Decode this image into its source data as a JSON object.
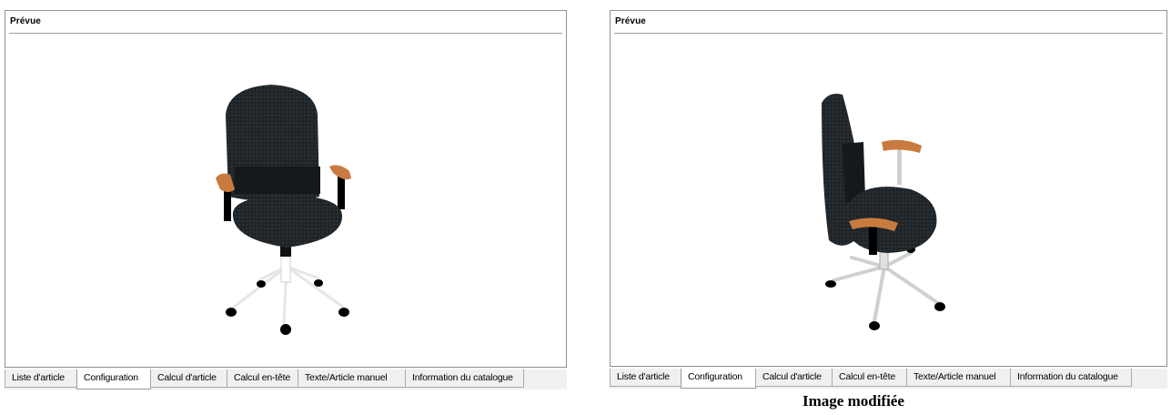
{
  "left_panel": {
    "title": "Prévue",
    "image": "office-chair-front-view",
    "tabs": [
      {
        "label": "Liste d'article",
        "active": false
      },
      {
        "label": "Configuration",
        "active": true
      },
      {
        "label": "Calcul d'article",
        "active": false
      },
      {
        "label": "Calcul en-tête",
        "active": false
      },
      {
        "label": "Texte/Article manuel",
        "active": false
      },
      {
        "label": "Information du catalogue",
        "active": false
      }
    ]
  },
  "right_panel": {
    "title": "Prévue",
    "image": "office-chair-side-view",
    "tabs": [
      {
        "label": "Liste d'article",
        "active": false
      },
      {
        "label": "Configuration",
        "active": true
      },
      {
        "label": "Calcul d'article",
        "active": false
      },
      {
        "label": "Calcul en-tête",
        "active": false
      },
      {
        "label": "Texte/Article manuel",
        "active": false
      },
      {
        "label": "Information du catalogue",
        "active": false
      }
    ],
    "caption": "Image modifiée"
  },
  "colors": {
    "upholstery": "#1f2428",
    "armrest": "#c97b3f",
    "frame": "#000000",
    "chrome": "#d8d8d8",
    "tabbar": "#f0f0f0"
  }
}
